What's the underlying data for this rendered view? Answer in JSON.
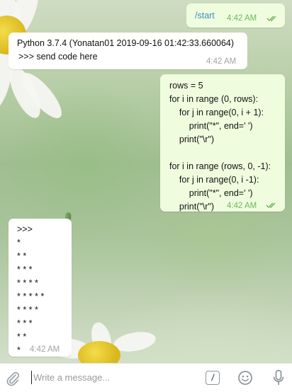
{
  "messages": [
    {
      "type": "out",
      "lines": [
        "/start"
      ],
      "time": "4:42 AM",
      "read": true
    },
    {
      "type": "in",
      "lines": [
        "Python 3.7.4 (Yonatan01 2019-09-16 01:42:33.660064)",
        ">>> send code here"
      ],
      "time": "4:42 AM"
    },
    {
      "type": "out",
      "lines": [
        "rows = 5",
        "for i in range (0, rows):",
        "    for j in range(0, i + 1):",
        "        print(\"*\", end=' ')",
        "    print(\"\\r\")",
        "",
        "for i in range (rows, 0, -1):",
        "    for j in range(0, i -1):",
        "        print(\"*\", end=' ')",
        "    print(\"\\r\")"
      ],
      "time": "4:42 AM",
      "read": true
    },
    {
      "type": "in",
      "lines": [
        ">>>",
        "*",
        "* *",
        "* * *",
        "* * * *",
        "* * * * *",
        "* * * *",
        "* * *",
        "* *",
        "*"
      ],
      "time": "4:42 AM"
    }
  ],
  "composer": {
    "placeholder": "Write a message...",
    "icons": [
      "paperclip-icon",
      "bot-command-icon",
      "emoji-icon",
      "microphone-icon"
    ],
    "command_glyph": "/"
  },
  "colors": {
    "outgoing_bubble": "#effdde",
    "incoming_bubble": "#ffffff",
    "outgoing_time": "#6fb55d",
    "link": "#3a8ec4",
    "icon": "#9aa2a8"
  }
}
